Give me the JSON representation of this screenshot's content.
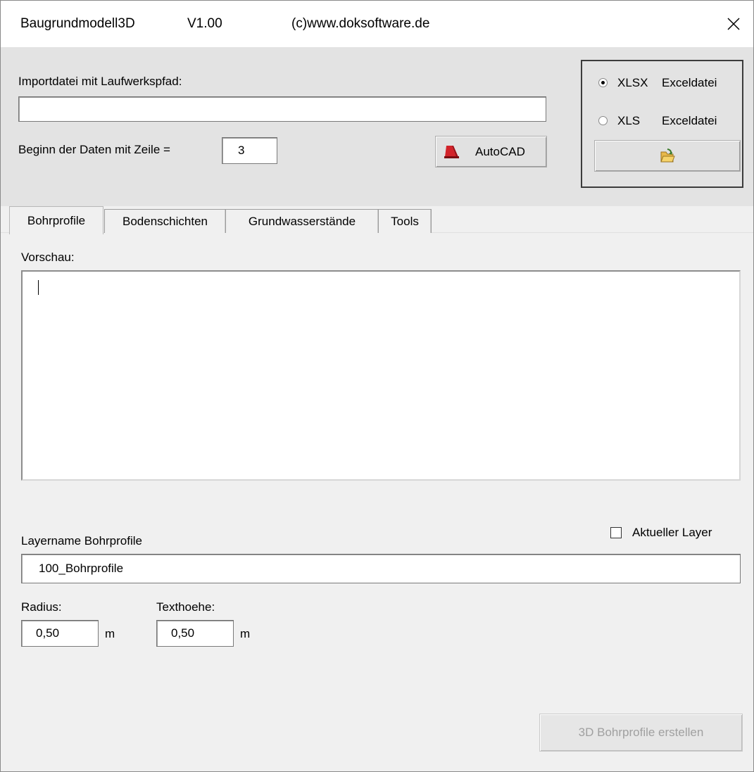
{
  "window": {
    "app_name": "Baugrundmodell3D",
    "version": "V1.00",
    "copyright": "(c)www.doksoftware.de",
    "close_icon": "close-icon"
  },
  "import": {
    "label": "Importdatei mit Laufwerkspfad:",
    "path_value": "",
    "start_row_label": "Beginn der Daten mit Zeile =",
    "start_row_value": "3",
    "autocad_button": "AutoCAD",
    "autocad_icon": "autocad-icon"
  },
  "file_format": {
    "options": [
      {
        "label": "XLSX",
        "desc": "Exceldatei",
        "selected": true
      },
      {
        "label": "XLS",
        "desc": "Exceldatei",
        "selected": false
      }
    ],
    "open_icon": "open-folder-icon"
  },
  "tabs": [
    {
      "label": "Bohrprofile",
      "active": true
    },
    {
      "label": "Bodenschichten",
      "active": false
    },
    {
      "label": "Grundwasserstände",
      "active": false
    },
    {
      "label": "Tools",
      "active": false
    }
  ],
  "bohrprofile": {
    "preview_label": "Vorschau:",
    "preview_text": "",
    "layer_label": "Layername Bohrprofile",
    "current_layer_label": "Aktueller Layer",
    "current_layer_checked": false,
    "layer_value": "100_Bohrprofile",
    "radius_label": "Radius:",
    "radius_value": "0,50",
    "radius_unit": "m",
    "text_height_label": "Texthoehe:",
    "text_height_value": "0,50",
    "text_height_unit": "m",
    "create_button": "3D Bohrprofile erstellen",
    "create_enabled": false
  },
  "colors": {
    "window_bg": "#f0f0f0",
    "top_panel_bg": "#e3e3e3",
    "autocad_red": "#d2232a",
    "disabled_text": "#a0a0a0"
  }
}
